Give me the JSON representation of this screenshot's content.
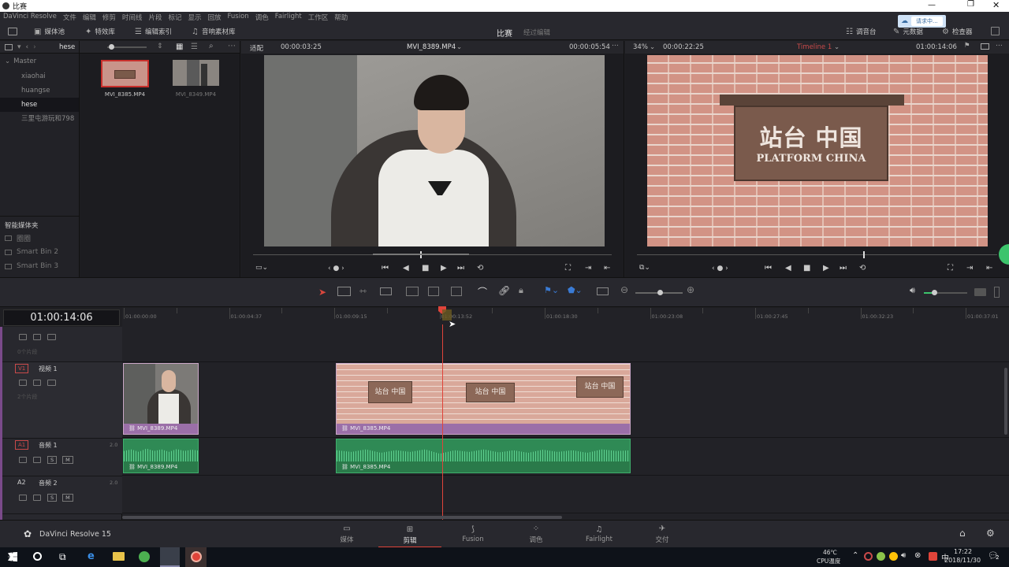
{
  "window": {
    "title": "比赛"
  },
  "menubar": {
    "items": [
      "DaVinci Resolve",
      "文件",
      "编辑",
      "修剪",
      "时间线",
      "片段",
      "标记",
      "显示",
      "回放",
      "Fusion",
      "调色",
      "Fairlight",
      "工作区",
      "帮助"
    ]
  },
  "toolbar": {
    "left": [
      "媒体池",
      "特效库",
      "编辑索引",
      "音响素材库"
    ],
    "center_title": "比赛",
    "center_status": "经过编辑",
    "right": [
      "调音台",
      "元数据",
      "检查器"
    ],
    "notification": "请求中..."
  },
  "bins": {
    "current": "hese",
    "master": "Master",
    "items": [
      "xiaohai",
      "huangse",
      "hese",
      "三里屯游玩和798"
    ],
    "smart_title": "智能媒体夹",
    "smart_items": [
      "圈圈",
      "Smart Bin 2",
      "Smart Bin 3"
    ]
  },
  "media": {
    "clips": [
      {
        "name": "MVI_8385.MP4"
      },
      {
        "name": "MVI_8349.MP4"
      }
    ]
  },
  "source_viewer": {
    "fit": "适配",
    "timecode": "00:00:03:25",
    "clip": "MVI_8389.MP4",
    "duration": "00:00:05:54"
  },
  "record_viewer": {
    "zoom": "34%",
    "duration": "00:00:22:25",
    "timeline": "Timeline 1",
    "timecode": "01:00:14:06",
    "sign_line1": "站台 中国",
    "sign_line2": "PLATFORM CHINA"
  },
  "timeline": {
    "timecode": "01:00:14:06",
    "ruler": [
      "01:00:00:00",
      "01:00:04:37",
      "01:00:09:15",
      "01:00:13:52",
      "01:00:18:30",
      "01:00:23:08",
      "01:00:27:45",
      "01:00:32:23",
      "01:00:37:01"
    ],
    "tracks": {
      "v2_clip_count": "0个片段",
      "v1_label": "V1",
      "v1_name": "视频 1",
      "v1_clip_count": "2个片段",
      "a1_label": "A1",
      "a1_name": "音频 1",
      "a1_level": "2.0",
      "a2_label": "A2",
      "a2_name": "音频 2",
      "a2_level": "2.0",
      "solo": "S",
      "mute": "M"
    },
    "clips": {
      "v1_clip1": "MVI_8389.MP4",
      "v1_clip2": "MVI_8385.MP4",
      "a1_clip1": "MVI_8389.MP4",
      "a1_clip2": "MVI_8385.MP4"
    },
    "sign_text": "站台 中国"
  },
  "bottom": {
    "app": "DaVinci Resolve 15",
    "pages": [
      "媒体",
      "剪辑",
      "Fusion",
      "调色",
      "Fairlight",
      "交付"
    ],
    "active": "剪辑"
  },
  "taskbar": {
    "temp": "46℃",
    "temp_label": "CPU温度",
    "time": "17:22",
    "date": "2018/11/30",
    "badge": "2"
  },
  "colors": {
    "clip_video_bar": "#9b6fa8",
    "clip_audio": "#2f8a55",
    "playhead": "#e0443a",
    "accent_red": "#c94a4a"
  }
}
